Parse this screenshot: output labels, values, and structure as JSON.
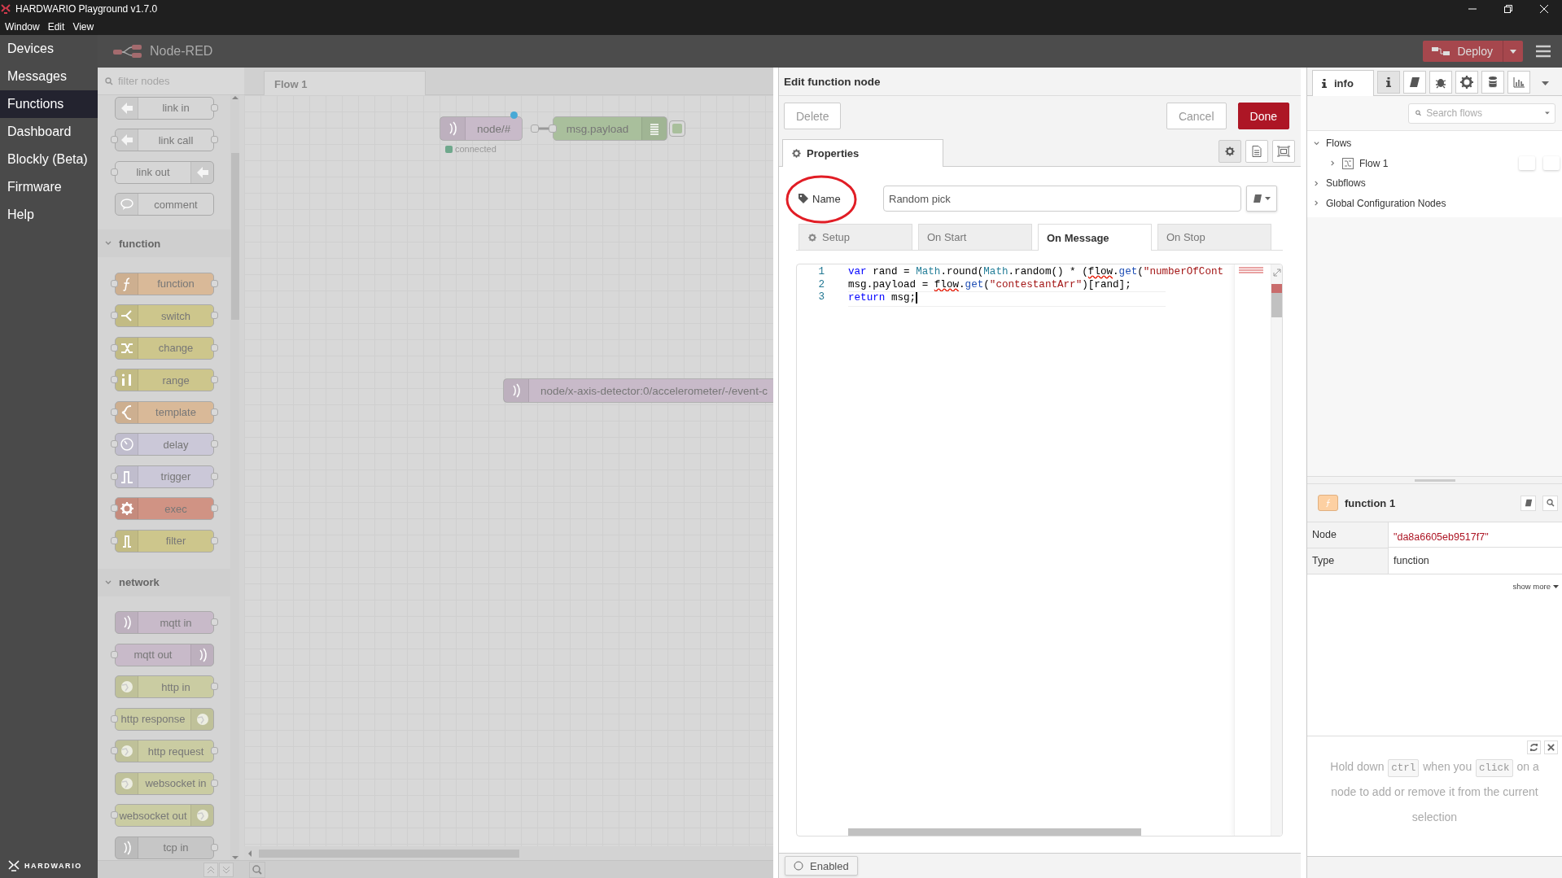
{
  "window": {
    "title": "HARDWARIO Playground v1.7.0",
    "menu": [
      "Window",
      "Edit",
      "View"
    ]
  },
  "nav": {
    "items": [
      {
        "label": "Devices",
        "selected": false
      },
      {
        "label": "Messages",
        "selected": false
      },
      {
        "label": "Functions",
        "selected": true
      },
      {
        "label": "Dashboard",
        "selected": false
      },
      {
        "label": "Blockly (Beta)",
        "selected": false
      },
      {
        "label": "Firmware",
        "selected": false
      },
      {
        "label": "Help",
        "selected": false
      }
    ],
    "logo": "HARDWARIO"
  },
  "header": {
    "title": "Node-RED",
    "deploy": "Deploy"
  },
  "palette": {
    "placeholder": "filter nodes",
    "sections": [
      {
        "nodes": [
          {
            "label": "link in",
            "kind": "link-in",
            "color": "#d6d6d6"
          },
          {
            "label": "link call",
            "kind": "link-call",
            "color": "#d6d6d6"
          },
          {
            "label": "link out",
            "kind": "link-out",
            "color": "#d6d6d6"
          },
          {
            "label": "comment",
            "kind": "comment",
            "color": "#d6d6d6"
          }
        ]
      },
      {
        "title": "function",
        "expanded": true,
        "nodes": [
          {
            "label": "function",
            "kind": "function",
            "color": "#d9b998"
          },
          {
            "label": "switch",
            "kind": "switch",
            "color": "#cdc68c"
          },
          {
            "label": "change",
            "kind": "change",
            "color": "#cdc68c"
          },
          {
            "label": "range",
            "kind": "range",
            "color": "#cdc68c"
          },
          {
            "label": "template",
            "kind": "template",
            "color": "#d9b998"
          },
          {
            "label": "delay",
            "kind": "delay",
            "color": "#cbc8d8"
          },
          {
            "label": "trigger",
            "kind": "trigger",
            "color": "#cbc8d8"
          },
          {
            "label": "exec",
            "kind": "exec",
            "color": "#d09384"
          },
          {
            "label": "filter",
            "kind": "filter",
            "color": "#cdc68c"
          }
        ]
      },
      {
        "title": "network",
        "expanded": true,
        "nodes": [
          {
            "label": "mqtt in",
            "kind": "mqtt-in",
            "color": "#c8bac9"
          },
          {
            "label": "mqtt out",
            "kind": "mqtt-out",
            "color": "#c8bac9"
          },
          {
            "label": "http in",
            "kind": "http-in",
            "color": "#cacca2"
          },
          {
            "label": "http response",
            "kind": "http-out",
            "color": "#cacca2"
          },
          {
            "label": "http request",
            "kind": "http-request",
            "color": "#cacca2"
          },
          {
            "label": "websocket in",
            "kind": "http-in",
            "color": "#cacca2"
          },
          {
            "label": "websocket out",
            "kind": "http-out",
            "color": "#cacca2"
          },
          {
            "label": "tcp in",
            "kind": "mqtt-in",
            "color": "#c6c6c6"
          }
        ]
      }
    ]
  },
  "workspace": {
    "tabs": [
      {
        "label": "Flow 1",
        "selected": true
      }
    ],
    "nodes": [
      {
        "label": "node/#",
        "kind": "mqtt-in",
        "color": "#c8bac9",
        "changed": true,
        "wired_to_next": true,
        "status": {
          "text": "connected",
          "color": "#6fa88c"
        }
      },
      {
        "label": "msg.payload",
        "kind": "debug",
        "color": "#a9bf9c",
        "changed": false,
        "wired_to_next": false
      },
      {
        "label": "node/x-axis-detector:0/accelerometer/-/event-c",
        "kind": "mqtt-in",
        "color": "#c8bac9",
        "changed": false
      }
    ]
  },
  "tray": {
    "title": "Edit function node",
    "buttons": [
      {
        "label": "Delete",
        "kind": "secondary"
      },
      {
        "label": "Cancel",
        "kind": "secondary"
      },
      {
        "label": "Done",
        "kind": "primary"
      }
    ],
    "tabs": [
      {
        "label": "Properties",
        "selected": true
      }
    ],
    "name": {
      "label": "Name",
      "value": "Random pick",
      "annotated": true
    },
    "subtabs": [
      {
        "label": "Setup",
        "selected": false,
        "kind": "settings"
      },
      {
        "label": "On Start",
        "selected": false,
        "kind": "code"
      },
      {
        "label": "On Message",
        "selected": true,
        "kind": "code"
      },
      {
        "label": "On Stop",
        "selected": false,
        "kind": "code"
      }
    ],
    "code": {
      "lines": [
        {
          "number": "1",
          "current": false,
          "tokens": [
            {
              "kind": "keyword",
              "text": "var",
              "squiggle": false
            },
            {
              "kind": "plain",
              "text": " rand = ",
              "squiggle": false
            },
            {
              "kind": "type",
              "text": "Math",
              "squiggle": false
            },
            {
              "kind": "plain",
              "text": ".round(",
              "squiggle": false
            },
            {
              "kind": "type",
              "text": "Math",
              "squiggle": false
            },
            {
              "kind": "plain",
              "text": ".random() * (",
              "squiggle": false
            },
            {
              "kind": "plain",
              "text": "flow",
              "squiggle": true
            },
            {
              "kind": "plain",
              "text": ".",
              "squiggle": false
            },
            {
              "kind": "method",
              "text": "get",
              "squiggle": false
            },
            {
              "kind": "plain",
              "text": "(",
              "squiggle": false
            },
            {
              "kind": "string",
              "text": "\"numberOfCont",
              "squiggle": false
            }
          ]
        },
        {
          "number": "2",
          "current": false,
          "tokens": [
            {
              "kind": "plain",
              "text": "msg.payload = ",
              "squiggle": false
            },
            {
              "kind": "plain",
              "text": "flow",
              "squiggle": true
            },
            {
              "kind": "plain",
              "text": ".",
              "squiggle": false
            },
            {
              "kind": "method",
              "text": "get",
              "squiggle": false
            },
            {
              "kind": "plain",
              "text": "(",
              "squiggle": false
            },
            {
              "kind": "string",
              "text": "\"contestantArr\"",
              "squiggle": false
            },
            {
              "kind": "plain",
              "text": ")[rand];",
              "squiggle": false
            }
          ]
        },
        {
          "number": "3",
          "current": true,
          "tokens": [
            {
              "kind": "keyword",
              "text": "return",
              "squiggle": false
            },
            {
              "kind": "plain",
              "text": " msg;",
              "squiggle": false
            }
          ]
        }
      ]
    },
    "enabled_label": "Enabled"
  },
  "sidebar": {
    "tabs": [
      {
        "label": "info",
        "selected": true
      }
    ],
    "tools": [
      {
        "kind": "info",
        "selected": true
      },
      {
        "kind": "book",
        "selected": false
      },
      {
        "kind": "bug",
        "selected": false
      },
      {
        "kind": "gear",
        "selected": false
      },
      {
        "kind": "database",
        "selected": false
      },
      {
        "kind": "chart",
        "selected": false
      }
    ],
    "search_placeholder": "Search flows",
    "tree": [
      {
        "label": "Flows",
        "expanded": true,
        "children": [
          {
            "label": "Flow 1",
            "kind": "flow",
            "expanded": false
          }
        ]
      },
      {
        "label": "Subflows",
        "expanded": false
      },
      {
        "label": "Global Configuration Nodes",
        "expanded": false
      }
    ],
    "node_info": {
      "title": "function 1",
      "rows": [
        {
          "key": "Node",
          "value": "\"da8a6605eb9517f7\"",
          "kind": "id"
        },
        {
          "key": "Type",
          "value": "function",
          "kind": "text"
        }
      ],
      "show_more": "show more"
    },
    "hint": {
      "parts": [
        {
          "kind": "text",
          "text": "Hold down"
        },
        {
          "kind": "key",
          "text": "ctrl"
        },
        {
          "kind": "text",
          "text": "when you"
        },
        {
          "kind": "key",
          "text": "click"
        },
        {
          "kind": "text",
          "text": "on a node to add or remove it from the current selection"
        }
      ]
    }
  }
}
